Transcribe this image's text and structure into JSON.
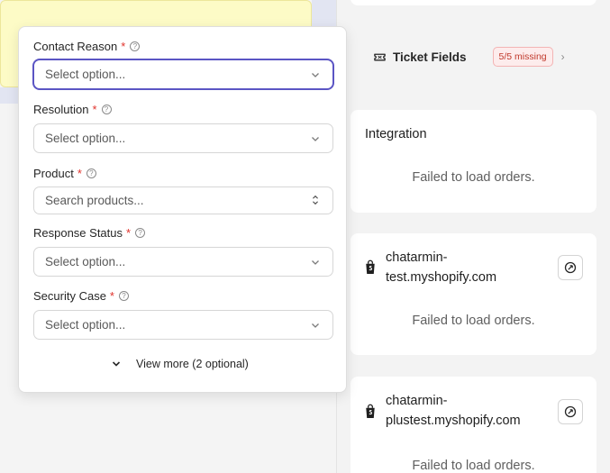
{
  "form": {
    "fields": [
      {
        "label": "Contact Reason",
        "required_mark": "*",
        "help_icon": "question-circle-icon",
        "placeholder": "Select option...",
        "control": "select",
        "active": true
      },
      {
        "label": "Resolution",
        "required_mark": "*",
        "help_icon": "question-circle-icon",
        "placeholder": "Select option...",
        "control": "select"
      },
      {
        "label": "Product",
        "required_mark": "*",
        "help_icon": "question-circle-icon",
        "placeholder": "Search products...",
        "control": "combobox"
      },
      {
        "label": "Response Status",
        "required_mark": "*",
        "help_icon": "question-circle-icon",
        "placeholder": "Select option...",
        "control": "select"
      },
      {
        "label": "Security Case",
        "required_mark": "*",
        "help_icon": "question-circle-icon",
        "placeholder": "Select option...",
        "control": "select"
      }
    ],
    "view_more_label": "View more (2 optional)"
  },
  "ticket_fields": {
    "label": "Ticket Fields",
    "missing_badge": "5/5 missing",
    "icon": "ticket-icon"
  },
  "integration": {
    "title": "Integration",
    "message": "Failed to load orders."
  },
  "shops": [
    {
      "name_line1": "chatarmin-",
      "name_line2": "test.myshopify.com",
      "message": "Failed to load orders.",
      "icon": "shopify-bag-icon",
      "action_icon": "sync-icon"
    },
    {
      "name_line1": "chatarmin-",
      "name_line2": "plustest.myshopify.com",
      "message": "Failed to load orders.",
      "icon": "shopify-bag-icon",
      "action_icon": "sync-icon"
    }
  ],
  "colors": {
    "accent": "#5b55c4",
    "required": "#e0322b",
    "badge_text": "#c0392b",
    "note_bg": "#fdfbc6"
  }
}
